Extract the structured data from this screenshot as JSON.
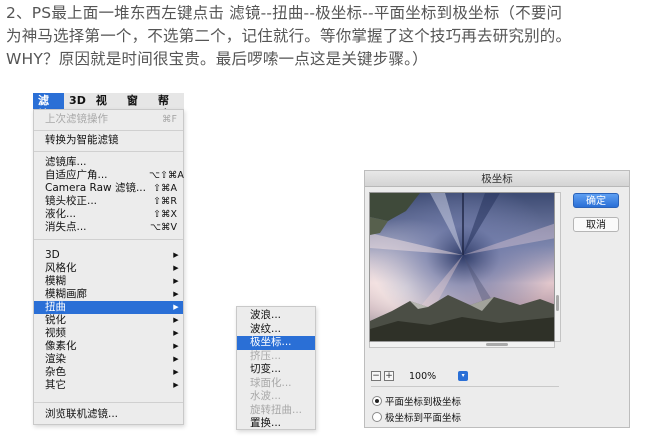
{
  "instruction": {
    "line1": "2、PS最上面一堆东西左键点击  滤镜--扭曲--极坐标--平面坐标到极坐标（不要问",
    "line2": "为神马选择第一个，不选第二个，记住就行。等你掌握了这个技巧再去研究别的。",
    "line3": "WHY？原因就是时间很宝贵。最后啰嗦一点这是关键步骤。）"
  },
  "menubar": {
    "items": [
      {
        "label": "滤镜",
        "active": true
      },
      {
        "label": "3D",
        "active": false
      },
      {
        "label": "视图",
        "active": false
      },
      {
        "label": "窗口",
        "active": false
      },
      {
        "label": "帮助",
        "active": false
      }
    ]
  },
  "filter_menu": {
    "items": [
      {
        "label": "上次滤镜操作",
        "shortcut": "⌘F",
        "disabled": true
      },
      {
        "label": "转换为智能滤镜"
      },
      {
        "label": "滤镜库..."
      },
      {
        "label": "自适应广角...",
        "shortcut": "⌥⇧⌘A"
      },
      {
        "label": "Camera Raw 滤镜...",
        "shortcut": "⇧⌘A"
      },
      {
        "label": "镜头校正...",
        "shortcut": "⇧⌘R"
      },
      {
        "label": "液化...",
        "shortcut": "⇧⌘X"
      },
      {
        "label": "消失点...",
        "shortcut": "⌥⌘V"
      },
      {
        "label": "3D",
        "submenu": true
      },
      {
        "label": "风格化",
        "submenu": true
      },
      {
        "label": "模糊",
        "submenu": true
      },
      {
        "label": "模糊画廊",
        "submenu": true
      },
      {
        "label": "扭曲",
        "submenu": true,
        "highlighted": true
      },
      {
        "label": "锐化",
        "submenu": true
      },
      {
        "label": "视频",
        "submenu": true
      },
      {
        "label": "像素化",
        "submenu": true
      },
      {
        "label": "渲染",
        "submenu": true
      },
      {
        "label": "杂色",
        "submenu": true
      },
      {
        "label": "其它",
        "submenu": true
      },
      {
        "label": "浏览联机滤镜..."
      }
    ]
  },
  "distort_submenu": {
    "items": [
      {
        "label": "波浪..."
      },
      {
        "label": "波纹..."
      },
      {
        "label": "极坐标...",
        "highlighted": true
      },
      {
        "label": "挤压...",
        "disabled": true
      },
      {
        "label": "切变..."
      },
      {
        "label": "球面化...",
        "disabled": true
      },
      {
        "label": "水波...",
        "disabled": true
      },
      {
        "label": "旋转扭曲...",
        "disabled": true
      },
      {
        "label": "置换..."
      }
    ]
  },
  "polar_dialog": {
    "title": "极坐标",
    "ok_label": "确定",
    "cancel_label": "取消",
    "zoom": "100%",
    "zoom_out_symbol": "−",
    "zoom_in_symbol": "+",
    "dropdown_symbol": "▾",
    "options": [
      {
        "label": "平面坐标到极坐标",
        "selected": true
      },
      {
        "label": "极坐标到平面坐标",
        "selected": false
      }
    ]
  },
  "colors": {
    "accent": "#2a6fd6",
    "menu_bg": "#ececec",
    "disabled_text": "#a8a8a8"
  },
  "icons": {
    "submenu_arrow": "▶"
  }
}
